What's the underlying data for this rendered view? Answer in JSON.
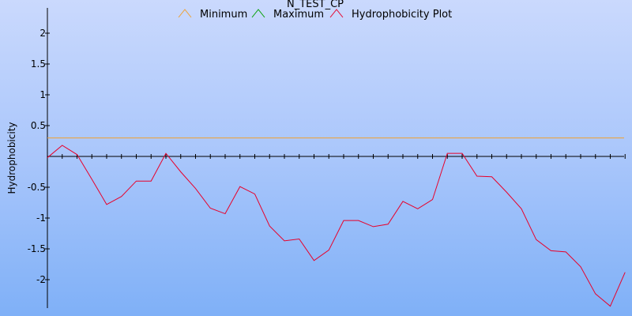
{
  "chart_data": {
    "type": "line",
    "title": "N_TEST_CP",
    "xlabel": "",
    "ylabel": "Hydrophobicity",
    "ylim": [
      -2.43,
      2.43
    ],
    "yticks": [
      2,
      1.5,
      1,
      0.5,
      -0.5,
      -1,
      -1.5,
      -2
    ],
    "grid": false,
    "legend_position": "top",
    "series": [
      {
        "name": "Minimum",
        "color": "#f0a030",
        "constant": 0.3
      },
      {
        "name": "Maximum",
        "color": "#00a000",
        "constant": null
      },
      {
        "name": "Hydrophobicity Plot",
        "color": "#e8002a",
        "x": [
          1,
          2,
          3,
          4,
          5,
          6,
          7,
          8,
          9,
          10,
          11,
          12,
          13,
          14,
          15,
          16,
          17,
          18,
          19,
          20,
          21,
          22,
          23,
          24,
          25,
          26,
          27,
          28,
          29,
          30,
          31,
          32,
          33,
          34,
          35,
          36,
          37,
          38,
          39,
          40
        ],
        "values": [
          -0.02,
          0.18,
          0.03,
          -0.37,
          -0.78,
          -0.65,
          -0.4,
          -0.4,
          0.05,
          -0.25,
          -0.52,
          -0.84,
          -0.93,
          -0.49,
          -0.61,
          -1.13,
          -1.37,
          -1.34,
          -1.69,
          -1.52,
          -1.04,
          -1.04,
          -1.14,
          -1.1,
          -0.73,
          -0.85,
          -0.7,
          0.05,
          0.05,
          -0.32,
          -0.33,
          -0.58,
          -0.85,
          -1.35,
          -1.53,
          -1.55,
          -1.79,
          -2.23,
          -2.43,
          -1.88
        ]
      }
    ]
  }
}
